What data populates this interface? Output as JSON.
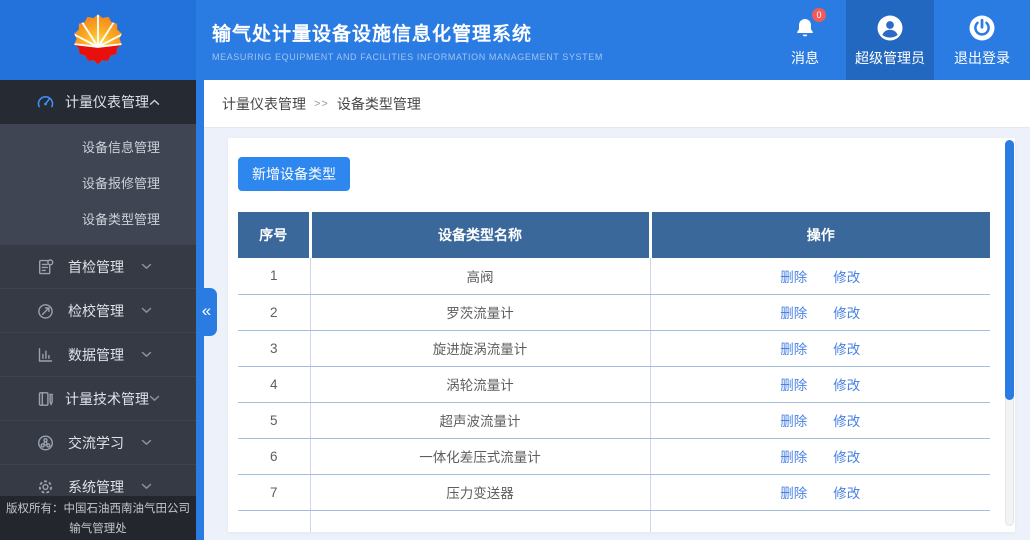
{
  "header": {
    "title": "输气处计量设备设施信息化管理系统",
    "subtitle": "MEASURING EQUIPMENT AND FACILITIES INFORMATION MANAGEMENT SYSTEM",
    "notifications": {
      "label": "消息",
      "badge": "0"
    },
    "user": {
      "label": "超级管理员"
    },
    "logout": {
      "label": "退出登录"
    }
  },
  "sidebar": {
    "menu": [
      {
        "label": "计量仪表管理",
        "icon": "gauge-icon",
        "expanded": true,
        "active": true,
        "children": [
          "设备信息管理",
          "设备报修管理",
          "设备类型管理"
        ]
      },
      {
        "label": "首检管理",
        "icon": "first-inspection-icon"
      },
      {
        "label": "检校管理",
        "icon": "calibration-icon"
      },
      {
        "label": "数据管理",
        "icon": "data-chart-icon"
      },
      {
        "label": "计量技术管理",
        "icon": "metering-tech-icon"
      },
      {
        "label": "交流学习",
        "icon": "exchange-icon"
      },
      {
        "label": "系统管理",
        "icon": "system-gear-icon"
      }
    ],
    "footer_line1": "版权所有：中国石油西南油气田公司",
    "footer_line2": "输气管理处"
  },
  "breadcrumb": {
    "parent": "计量仪表管理",
    "separator": ">>",
    "current": "设备类型管理"
  },
  "main": {
    "add_button": "新增设备类型",
    "table": {
      "columns": [
        "序号",
        "设备类型名称",
        "操作"
      ],
      "rows": [
        {
          "no": "1",
          "name": "高阀"
        },
        {
          "no": "2",
          "name": "罗茨流量计"
        },
        {
          "no": "3",
          "name": "旋进旋涡流量计"
        },
        {
          "no": "4",
          "name": "涡轮流量计"
        },
        {
          "no": "5",
          "name": "超声波流量计"
        },
        {
          "no": "6",
          "name": "一体化差压式流量计"
        },
        {
          "no": "7",
          "name": "压力变送器"
        }
      ],
      "actions": {
        "delete": "删除",
        "edit": "修改"
      }
    }
  },
  "colors": {
    "header_blue": "#2a7be2",
    "sidebar_dark": "#353a45",
    "table_header_blue": "#3b689b",
    "button_blue": "#2e87ee",
    "link_blue": "#4a82e4",
    "badge_red": "#f45a5a",
    "green_tab": "#3bbd70"
  }
}
